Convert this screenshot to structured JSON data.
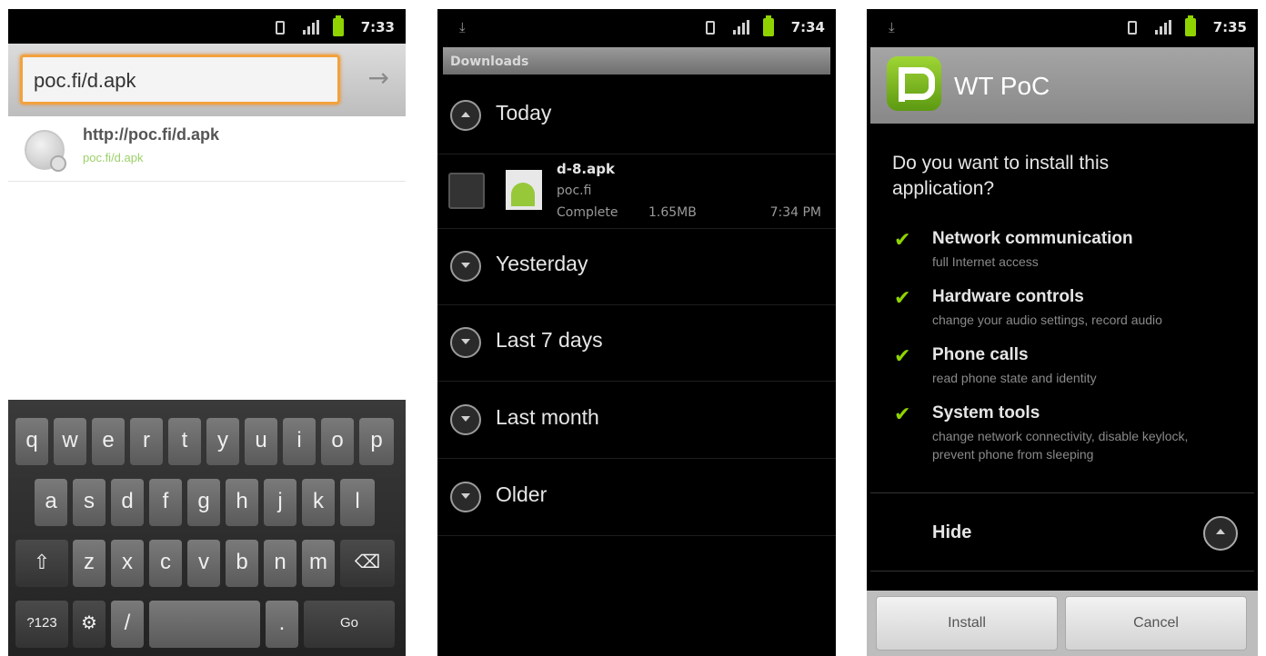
{
  "screens": {
    "browser": {
      "status_time": "7:33",
      "url_value": "poc.fi/d.apk",
      "go_arrow": "→",
      "suggestion": {
        "url": "http://poc.fi/d.apk",
        "sub": "poc.fi/d.apk"
      },
      "keyboard": {
        "row1": [
          "q",
          "w",
          "e",
          "r",
          "t",
          "y",
          "u",
          "i",
          "o",
          "p"
        ],
        "row2": [
          "a",
          "s",
          "d",
          "f",
          "g",
          "h",
          "j",
          "k",
          "l"
        ],
        "row3": [
          "z",
          "x",
          "c",
          "v",
          "b",
          "n",
          "m"
        ],
        "key_123": "?123",
        "key_slash": "/",
        "key_dot": ".",
        "key_go": "Go"
      }
    },
    "downloads": {
      "status_time": "7:34",
      "header": "Downloads",
      "groups": [
        "Today",
        "Yesterday",
        "Last 7 days",
        "Last month",
        "Older"
      ],
      "item": {
        "name": "d-8.apk",
        "host": "poc.fi",
        "status": "Complete",
        "size": "1.65MB",
        "time": "7:34 PM"
      }
    },
    "installer": {
      "status_time": "7:35",
      "app_name": "WT PoC",
      "question": "Do you want to install this application?",
      "permissions": [
        {
          "title": "Network communication",
          "desc": "full Internet access"
        },
        {
          "title": "Hardware controls",
          "desc": "change your audio settings, record audio"
        },
        {
          "title": "Phone calls",
          "desc": "read phone state and identity"
        },
        {
          "title": "System tools",
          "desc": "change network connectivity, disable keylock, prevent phone from sleeping"
        }
      ],
      "check_mark": "✔",
      "hide_label": "Hide",
      "install_label": "Install",
      "cancel_label": "Cancel"
    }
  },
  "colors": {
    "accent_green": "#8fd400",
    "focus_orange": "#f1a23d"
  }
}
